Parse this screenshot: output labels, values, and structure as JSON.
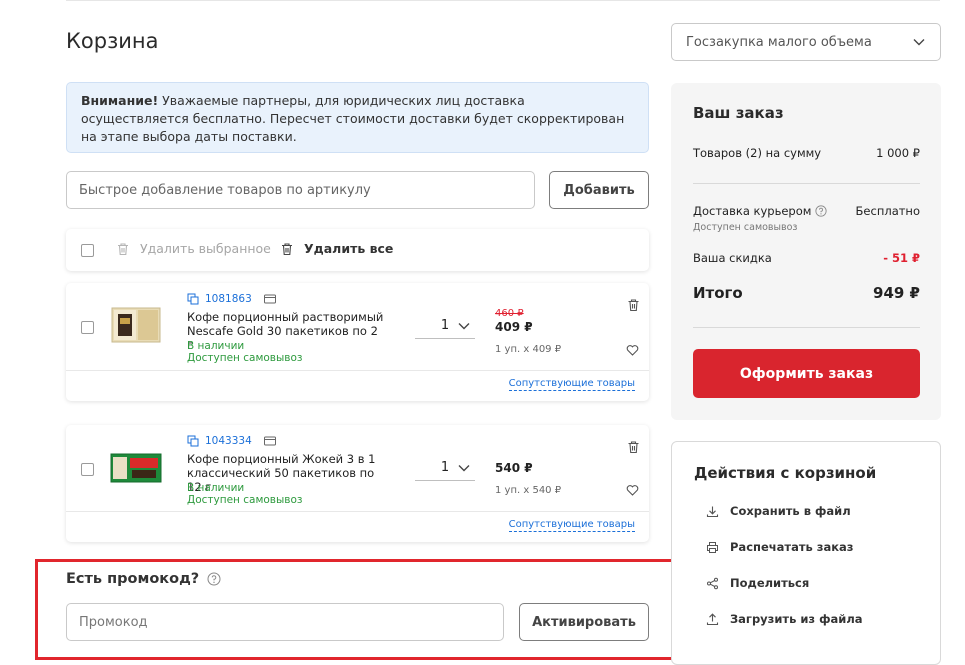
{
  "page": {
    "title": "Корзина"
  },
  "purchase_type": {
    "selected": "Госзакупка малого объема"
  },
  "notice": {
    "bold": "Внимание!",
    "text": " Уважаемые партнеры, для юридических лиц доставка осуществляется бесплатно. Пересчет стоимости доставки будет скорректирован на этапе выбора даты поставки."
  },
  "quick_add": {
    "placeholder": "Быстрое добавление товаров по артикулу",
    "button": "Добавить"
  },
  "toolbar": {
    "delete_selected": "Удалить выбранное",
    "delete_all": "Удалить все"
  },
  "items": [
    {
      "article": "1081863",
      "name": "Кофе порционный растворимый Nescafe Gold 30 пакетиков по 2 г",
      "in_stock": "В наличии",
      "pickup": "Доступен самовывоз",
      "quantity": "1",
      "old_price": "460 ₽",
      "price": "409 ₽",
      "unit_price": "1 уп. x 409 ₽",
      "related": "Сопутствующие товары"
    },
    {
      "article": "1043334",
      "name": "Кофе порционный Жокей 3 в 1 классический 50 пакетиков по 12 г",
      "in_stock": "В наличии",
      "pickup": "Доступен самовывоз",
      "quantity": "1",
      "old_price": "",
      "price": "540 ₽",
      "unit_price": "1 уп. x 540 ₽",
      "related": "Сопутствующие товары"
    }
  ],
  "promo": {
    "title": "Есть промокод?",
    "placeholder": "Промокод",
    "button": "Активировать"
  },
  "order": {
    "title": "Ваш заказ",
    "goods_label": "Товаров (2) на сумму",
    "goods_value": "1 000 ₽",
    "delivery_label": "Доставка курьером",
    "delivery_value": "Бесплатно",
    "pickup_note": "Доступен самовывоз",
    "discount_label": "Ваша скидка",
    "discount_value": "- 51 ₽",
    "total_label": "Итого",
    "total_value": "949 ₽",
    "checkout": "Оформить заказ"
  },
  "cart_actions": {
    "title": "Действия с корзиной",
    "save": "Сохранить в файл",
    "print": "Распечатать заказ",
    "share": "Поделиться",
    "upload": "Загрузить из файла"
  },
  "colors": {
    "accent_red": "#d9252e",
    "link_blue": "#1b6fd8",
    "stock_green": "#2e9a3e",
    "notice_bg": "#e9f2fc"
  }
}
